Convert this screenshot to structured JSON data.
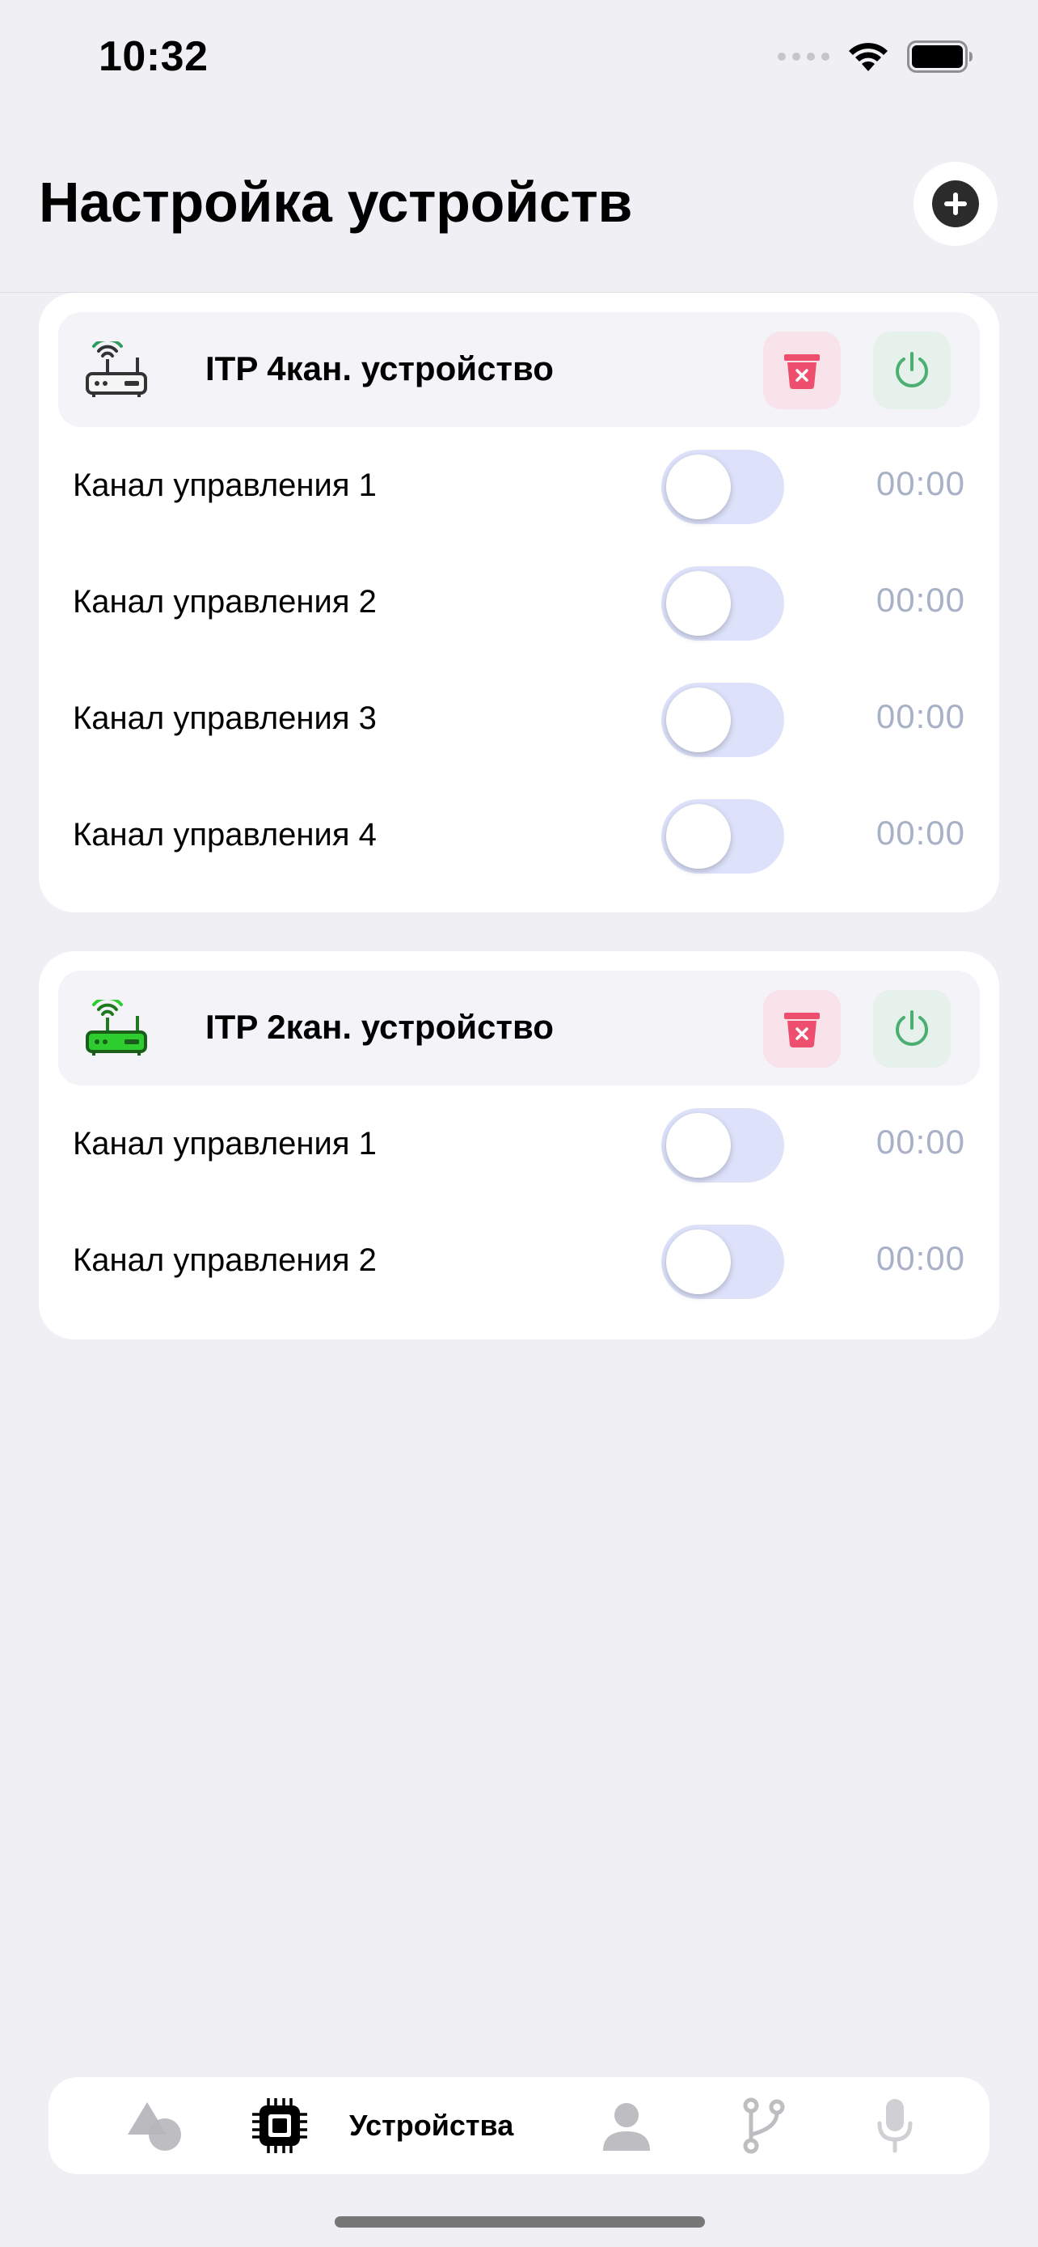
{
  "status_bar": {
    "time": "10:32",
    "icons": [
      "signal-dots-icon",
      "wifi-icon",
      "battery-icon"
    ]
  },
  "header": {
    "title": "Настройка устройств",
    "add_icon": "plus-circle-icon"
  },
  "devices": [
    {
      "name": "ITP 4кан. устройство",
      "icon_color": "#4a4a4a",
      "channels": [
        {
          "label": "Канал управления 1",
          "on": false,
          "time": "00:00"
        },
        {
          "label": "Канал управления 2",
          "on": false,
          "time": "00:00"
        },
        {
          "label": "Канал управления 3",
          "on": false,
          "time": "00:00"
        },
        {
          "label": "Канал управления 4",
          "on": false,
          "time": "00:00"
        }
      ]
    },
    {
      "name": "ITP 2кан. устройство",
      "icon_color": "#2ecc2e",
      "channels": [
        {
          "label": "Канал управления 1",
          "on": false,
          "time": "00:00"
        },
        {
          "label": "Канал управления 2",
          "on": false,
          "time": "00:00"
        }
      ]
    }
  ],
  "colors": {
    "delete": "#ef4f6f",
    "power": "#4caf72",
    "toggle_off": "#dde2fa",
    "background": "#f0eff4"
  },
  "tab_bar": {
    "items": [
      {
        "icon": "shapes-icon",
        "active": false
      },
      {
        "icon": "chip-icon",
        "label": "Устройства",
        "active": true
      },
      {
        "icon": "person-icon",
        "active": false
      },
      {
        "icon": "branch-icon",
        "active": false
      },
      {
        "icon": "microphone-icon",
        "active": false
      }
    ]
  }
}
